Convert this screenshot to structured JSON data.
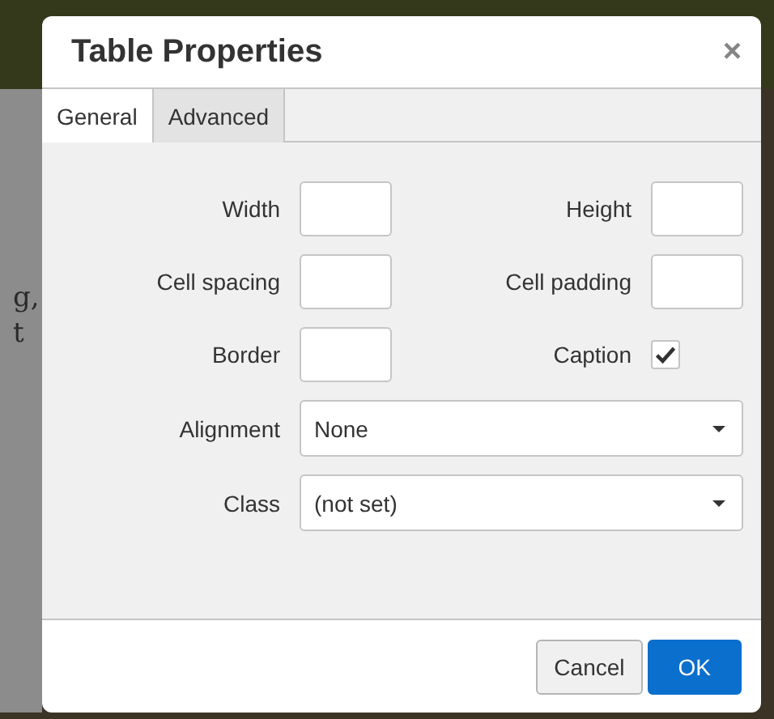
{
  "background_text": [
    "g,",
    "t"
  ],
  "dialog": {
    "title": "Table Properties",
    "close": "×"
  },
  "tabs": [
    {
      "label": "General",
      "selected": true
    },
    {
      "label": "Advanced",
      "selected": false
    }
  ],
  "rows": [
    [
      {
        "label": "Width",
        "kind": "text"
      },
      {
        "label": "Height",
        "kind": "text"
      }
    ],
    [
      {
        "label": "Cell spacing",
        "kind": "text"
      },
      {
        "label": "Cell padding",
        "kind": "text"
      }
    ],
    [
      {
        "label": "Border",
        "kind": "text"
      },
      {
        "label": "Caption",
        "kind": "checkbox",
        "checked": true
      }
    ],
    [
      {
        "label": "Alignment",
        "kind": "select",
        "value": "None"
      }
    ],
    [
      {
        "label": "Class",
        "kind": "select",
        "value": "(not set)"
      }
    ]
  ],
  "buttons": [
    {
      "label": "Cancel",
      "primary": false
    },
    {
      "label": "OK",
      "primary": true
    }
  ]
}
